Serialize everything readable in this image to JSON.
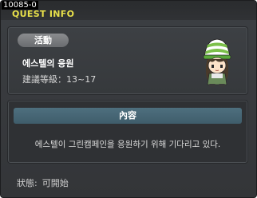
{
  "quest": {
    "id": "10085-0",
    "window_title": "QUEST INFO",
    "category_badge": "活動",
    "name": "에스텔의 응원",
    "level_requirement": "建議等級：13~17",
    "content_header": "內容",
    "description": "에스텔이 그린캠페인을 응원하기 위해 기다리고 있다.",
    "status_label": "狀態:",
    "status_value": "可開始"
  },
  "colors": {
    "title": "#e8e04a",
    "content_header_bg": "#4e6f7e",
    "window_bg": "#3a3d41"
  },
  "icons": {
    "npc": "npc-estelle-portrait"
  }
}
